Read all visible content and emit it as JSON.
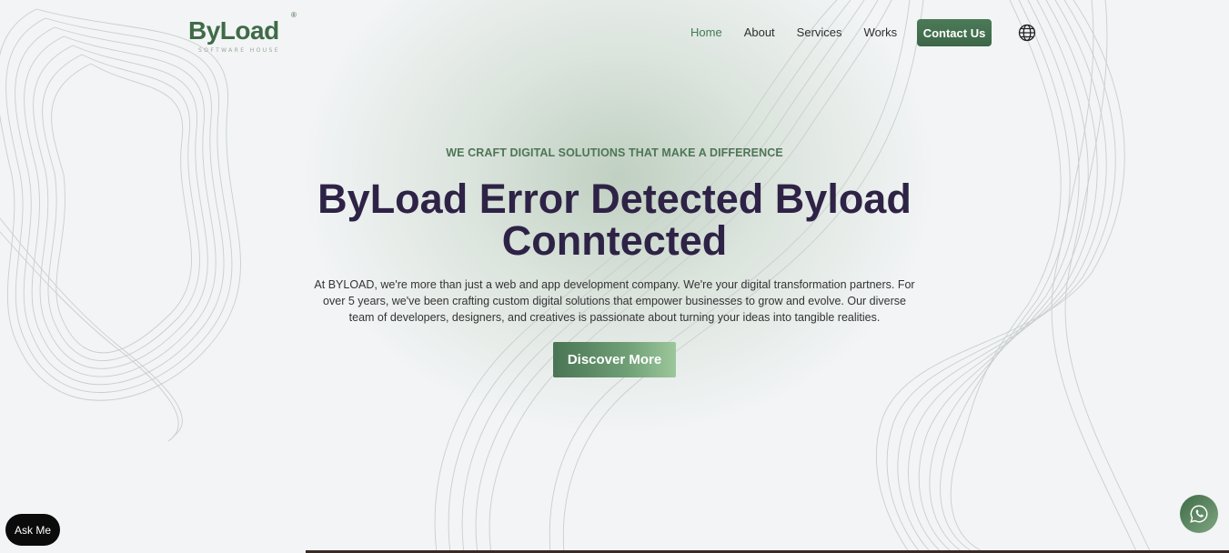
{
  "brand": {
    "logo_text": "ByLoad",
    "logo_subtitle": "SOFTWARE HOUSE",
    "registered_mark": "®",
    "color": "#3f6b47"
  },
  "nav": {
    "items": [
      {
        "label": "Home",
        "active": true
      },
      {
        "label": "About",
        "active": false
      },
      {
        "label": "Services",
        "active": false
      },
      {
        "label": "Works",
        "active": false
      }
    ],
    "contact_label": "Contact Us",
    "language_icon": "globe-icon"
  },
  "hero": {
    "eyebrow": "WE CRAFT DIGITAL SOLUTIONS THAT MAKE A DIFFERENCE",
    "title": "ByLoad Error Detected Byload Conntected",
    "description": "At BYLOAD, we're more than just a web and app development company. We're your digital transformation partners. For over 5 years, we've been crafting custom digital solutions that empower businesses to grow and evolve. Our diverse team of developers, designers, and creatives is passionate about turning your ideas into tangible realities.",
    "cta_label": "Discover More"
  },
  "floating": {
    "ask_label": "Ask Me",
    "whatsapp_icon": "whatsapp-icon"
  },
  "colors": {
    "accent": "#3f6b47",
    "title": "#2e2346",
    "background": "#f2f4f5"
  }
}
